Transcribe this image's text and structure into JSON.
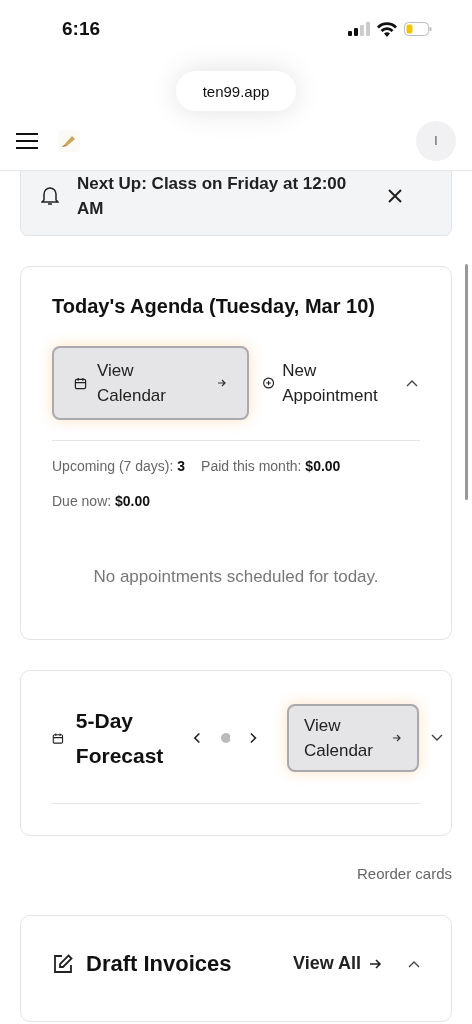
{
  "status_bar": {
    "time": "6:16"
  },
  "browser": {
    "url": "ten99.app"
  },
  "header": {
    "avatar": "I"
  },
  "banner": {
    "text": "Next Up: Class on Friday at 12:00 AM"
  },
  "cards": [
    {
      "kind": "agenda",
      "title": "Today's Agenda (Tuesday, Mar 10)",
      "expanded": true,
      "primary_button": "View Calendar",
      "secondary_button": "New Appointment",
      "stats": [
        "Upcoming (7 days): **3**",
        "Paid this month: **$0.00**",
        "Due now: **$0.00**"
      ],
      "empty": "No appointments scheduled for today."
    },
    {
      "kind": "forecast",
      "title": "5-Day Forecast",
      "expanded": false,
      "primary_button": "View Calendar"
    },
    {
      "kind": "reorder",
      "label": "Reorder cards"
    },
    {
      "kind": "drafts",
      "title": "Draft Invoices",
      "expanded": true,
      "link": "View All"
    }
  ]
}
